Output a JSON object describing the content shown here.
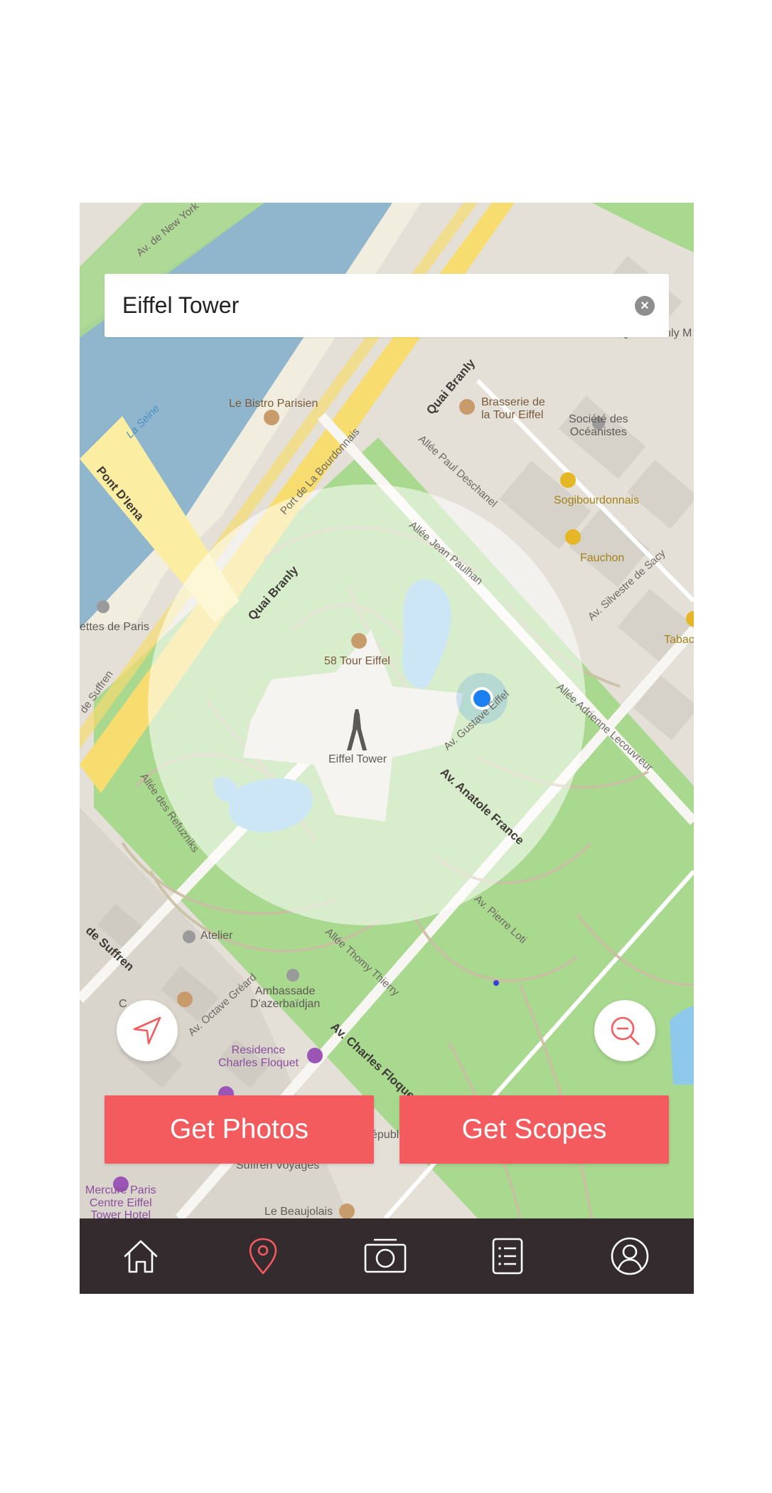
{
  "search": {
    "value": "Eiffel Tower",
    "clear_icon": "close-icon"
  },
  "map": {
    "labels": {
      "av_de_new_york": "Av. de New York",
      "la_seine": "La Seine",
      "pont_diena": "Pont D'Iena",
      "le_bistro_parisien": "Le Bistro Parisien",
      "quai_branly_top": "Quai Branly",
      "port_de_la_bourdonnais": "Port de La Bourdonnais",
      "brasserie": "Brasserie de\nla Tour Eiffel",
      "allee_paul_deschanel": "Allée Paul Deschanel",
      "societe_des_oceanistes": "Société des\nOcéanistes",
      "sogibourdonnais": "Sogibourdonnais",
      "allee_jean_paulhan": "Allée Jean Paulhan",
      "fauchon": "Fauchon",
      "av_silvestre_de_sacy": "Av. Silvestre de Sacy",
      "tabac": "Tabac",
      "ettes_de_paris": "ettes de Paris",
      "quai_branly_mid": "Quai Branly",
      "58_tour_eiffel": "58 Tour Eiffel",
      "de_suffren_left": "de Suffren",
      "allee_adrienne_lecouvreur": "Allée Adrienne Lecouvreur",
      "eiffel_tower": "Eiffel Tower",
      "av_gustave_eiffel": "Av. Gustave Eiffel",
      "av_anatole_france": "Av. Anatole France",
      "allee_des_refuzniks": "Allée des Refuzniks",
      "av_pierre_loti": "Av. Pierre Loti",
      "atelier": "Atelier",
      "de_suffren_bottom": "de Suffren",
      "allee_thomy_thierry": "Allée Thomy Thierry",
      "ambassade": "Ambassade\nD'azerbaïdjan",
      "av_octave_greard": "Av. Octave Gréard",
      "av_charles_floquet": "Av. Charles Floquet",
      "residence_charles_floquet": "Residence\nCharles Floquet",
      "republique": "épublique",
      "suffren_voyages": "Suffren Voyages",
      "mercure": "Mercure Paris\nCentre Eiffel\nTower Hotel",
      "le_beaujolais": "Le Beaujolais",
      "quai_branly_museum": "Quai Branly M",
      "c_partial": "C"
    },
    "colors": {
      "land": "#e4e0d8",
      "water": "#8fb6cc",
      "park": "#a9d88f",
      "highway": "#f7dc6f",
      "accent": "#f45b5e",
      "location_dot": "#1a7ff0"
    }
  },
  "buttons": {
    "locate_icon": "navigation-arrow-icon",
    "zoom_out_icon": "zoom-out-icon",
    "get_photos": "Get Photos",
    "get_scopes": "Get Scopes"
  },
  "tabbar": {
    "tabs": [
      {
        "icon": "home-icon",
        "active": false
      },
      {
        "icon": "map-pin-icon",
        "active": true
      },
      {
        "icon": "camera-icon",
        "active": false
      },
      {
        "icon": "list-icon",
        "active": false
      },
      {
        "icon": "profile-icon",
        "active": false
      }
    ],
    "active_color": "#f45b5e",
    "inactive_color": "#ffffff"
  }
}
